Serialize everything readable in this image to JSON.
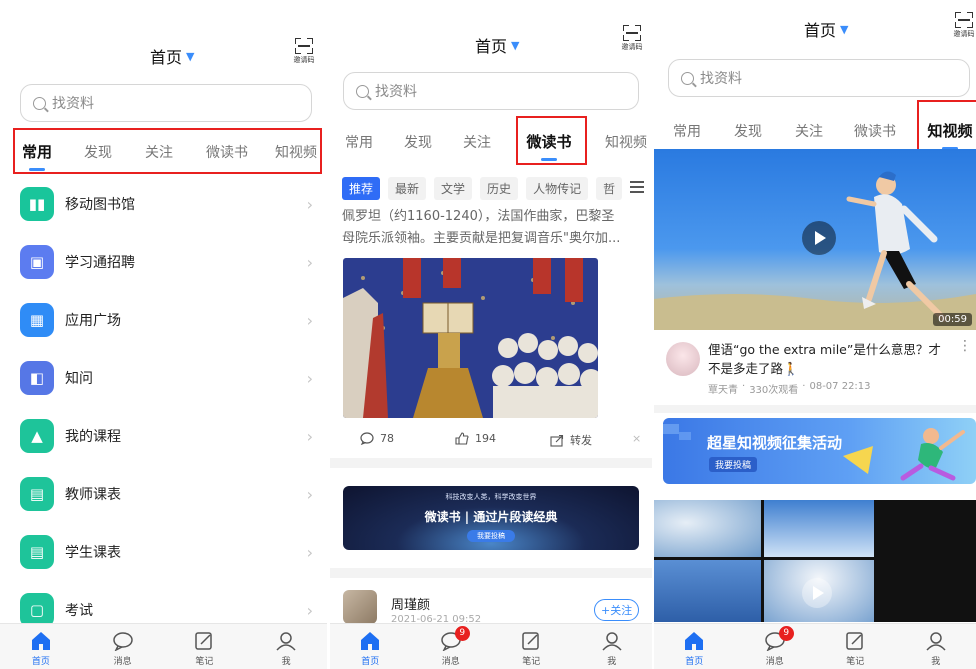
{
  "colors": {
    "accent": "#3a8dfb",
    "highlight": "#e8201f",
    "badge": "#e8201f"
  },
  "panels": [
    {
      "title": "首页",
      "qr_label": "邀请码",
      "search_placeholder": "找资料",
      "tabs": [
        "常用",
        "发现",
        "关注",
        "微读书",
        "知视频"
      ],
      "active_tab": "常用",
      "menu": [
        {
          "label": "移动图书馆",
          "icon": "library-icon",
          "color": "#19c59b"
        },
        {
          "label": "学习通招聘",
          "icon": "briefcase-icon",
          "color": "#5c7cf0"
        },
        {
          "label": "应用广场",
          "icon": "apps-grid-icon",
          "color": "#2f8cf6"
        },
        {
          "label": "知问",
          "icon": "qa-icon",
          "color": "#5677e6"
        },
        {
          "label": "我的课程",
          "icon": "graduation-cap-icon",
          "color": "#1ec49a"
        },
        {
          "label": "教师课表",
          "icon": "calendar-icon",
          "color": "#1ec49a"
        },
        {
          "label": "学生课表",
          "icon": "calendar-icon",
          "color": "#1ec49a"
        },
        {
          "label": "考试",
          "icon": "exam-icon",
          "color": "#1ec49a"
        }
      ],
      "bottom_nav": [
        {
          "label": "首页",
          "icon": "home-icon",
          "active": true
        },
        {
          "label": "消息",
          "icon": "message-icon"
        },
        {
          "label": "笔记",
          "icon": "note-icon"
        },
        {
          "label": "我",
          "icon": "user-icon"
        }
      ]
    },
    {
      "title": "首页",
      "qr_label": "邀请码",
      "search_placeholder": "找资料",
      "tabs": [
        "常用",
        "发现",
        "关注",
        "微读书",
        "知视频"
      ],
      "active_tab": "微读书",
      "subtabs": [
        "推荐",
        "最新",
        "文学",
        "历史",
        "人物传记",
        "哲"
      ],
      "article": {
        "excerpt_line1": "佩罗坦（约1160-1240），法国作曲家，巴黎圣",
        "excerpt_line2": "母院乐派领袖。主要贡献是把复调音乐\"奥尔加...",
        "comments": "78",
        "likes": "194",
        "share": "转发"
      },
      "banner": {
        "top_line": "科技改变人类，科学改变世界",
        "main_line": "微读书 | 通过片段读经典",
        "button": "我要投稿"
      },
      "next_author": {
        "name": "周瑾颜",
        "follow": "+关注",
        "date": "2021-06-21 09:52"
      },
      "bottom_nav": [
        {
          "label": "首页",
          "icon": "home-icon",
          "active": true
        },
        {
          "label": "消息",
          "icon": "message-icon",
          "badge": "9"
        },
        {
          "label": "笔记",
          "icon": "note-icon"
        },
        {
          "label": "我",
          "icon": "user-icon"
        }
      ]
    },
    {
      "title": "首页",
      "qr_label": "邀请码",
      "search_placeholder": "找资料",
      "tabs": [
        "常用",
        "发现",
        "关注",
        "微读书",
        "知视频"
      ],
      "active_tab": "知视频",
      "video": {
        "duration": "00:59",
        "title_line1": "俚语“go the extra mile”是什么意思？才",
        "title_line2": "不是多走了路🚶",
        "author": "覃天青",
        "views": "330次观看",
        "date": "08-07 22:13"
      },
      "promo": {
        "title": "超星知视频征集活动",
        "button": "我要投稿"
      },
      "bottom_nav": [
        {
          "label": "首页",
          "icon": "home-icon",
          "active": true
        },
        {
          "label": "消息",
          "icon": "message-icon",
          "badge": "9"
        },
        {
          "label": "笔记",
          "icon": "note-icon"
        },
        {
          "label": "我",
          "icon": "user-icon"
        }
      ]
    }
  ]
}
